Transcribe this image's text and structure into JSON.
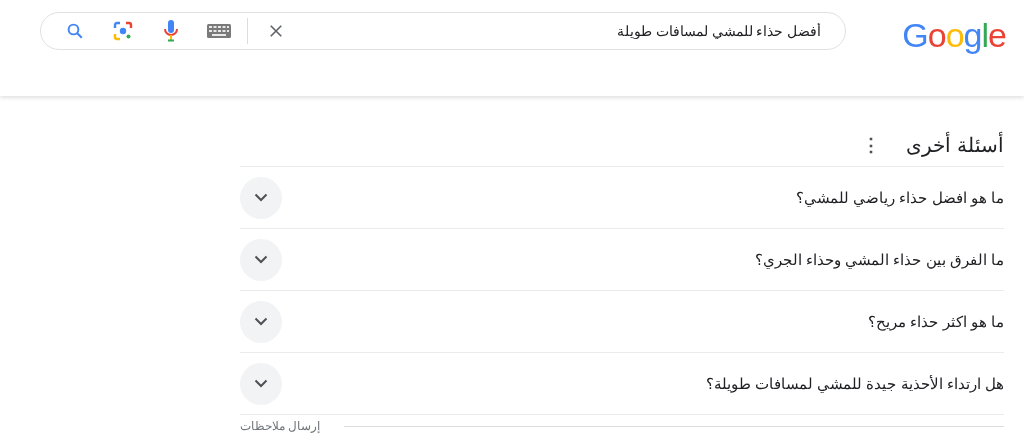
{
  "logo": "Google",
  "search": {
    "value": "أفضل حذاء للمشي لمسافات طويلة"
  },
  "section": {
    "title": "أسئلة أخرى",
    "menu": "⋮"
  },
  "questions": [
    {
      "text": "ما هو افضل حذاء رياضي للمشي؟",
      "expanded": false
    },
    {
      "text": "ما الفرق بين حذاء المشي وحذاء الجري؟",
      "expanded": false
    },
    {
      "text": "ما هو اكثر حذاء مريح؟",
      "expanded": false
    },
    {
      "text": "هل ارتداء الأحذية جيدة للمشي لمسافات طويلة؟",
      "expanded": false
    }
  ],
  "feedback": "إرسال ملاحظات"
}
